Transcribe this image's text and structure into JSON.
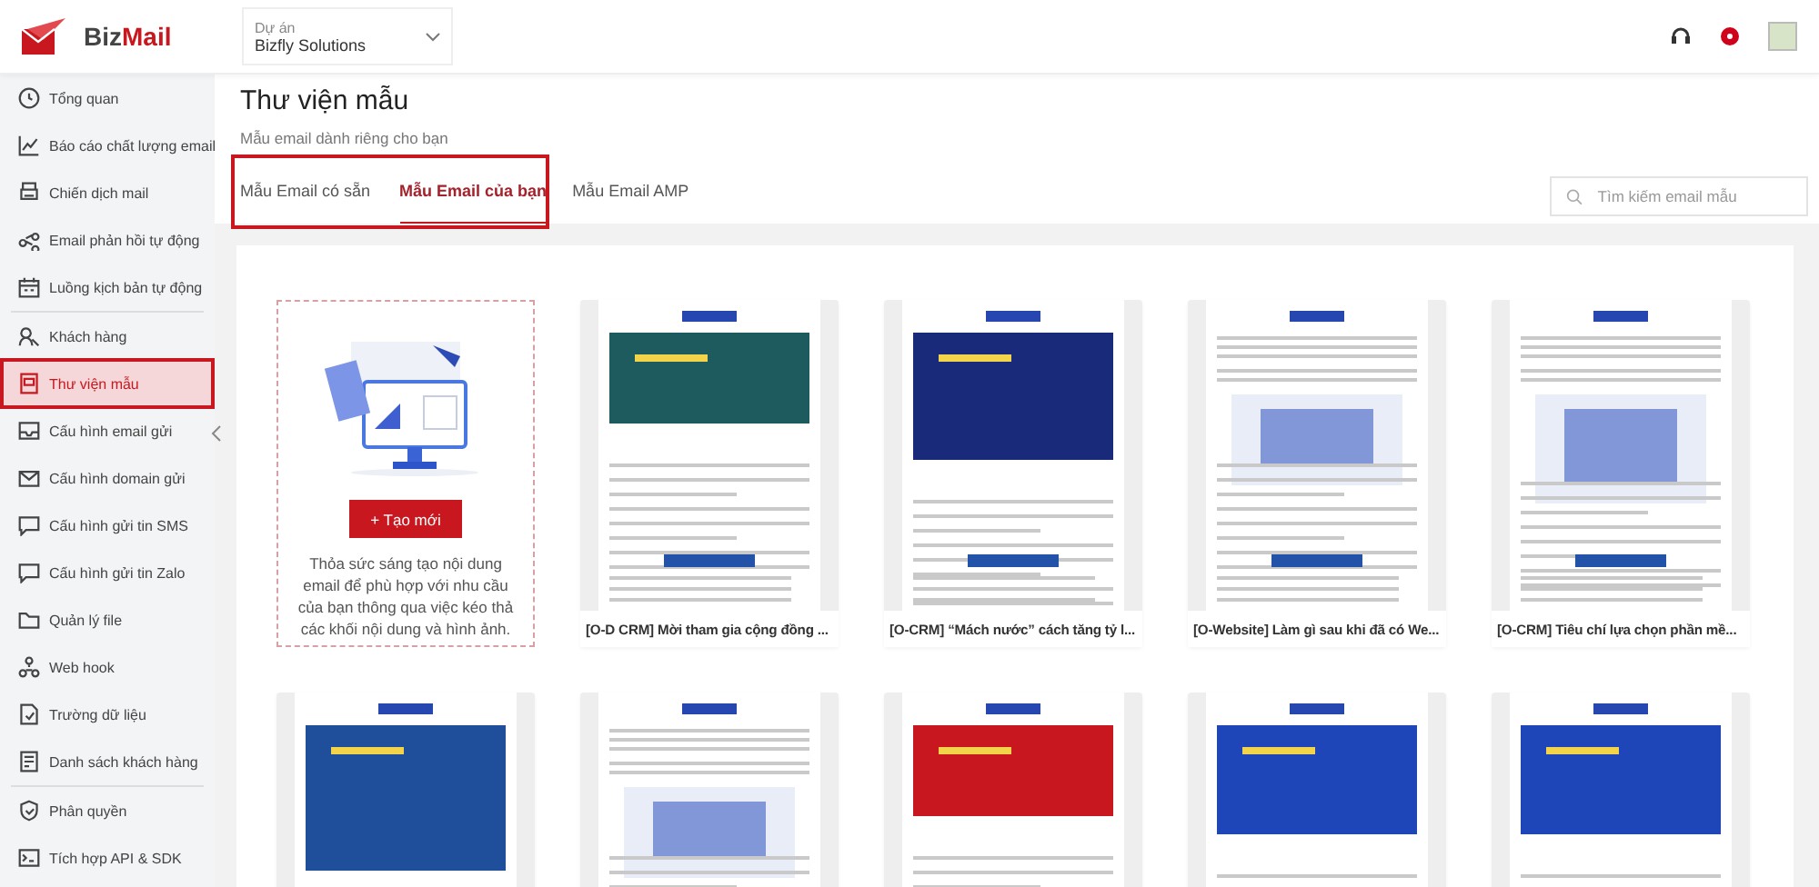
{
  "logo": {
    "first": "Biz",
    "second": "Mail"
  },
  "project_selector": {
    "label": "Dự án",
    "value": "Bizfly Solutions"
  },
  "header": {
    "notification": true
  },
  "sidebar": {
    "groups": [
      {
        "items": [
          {
            "label": "Tổng quan",
            "selected": false
          },
          {
            "label": "Báo cáo chất lượng email",
            "selected": false
          },
          {
            "label": "Chiến dịch mail",
            "selected": false
          },
          {
            "label": "Email phản hồi tự động",
            "selected": false
          },
          {
            "label": "Luồng kịch bản tự động",
            "selected": false
          }
        ]
      },
      {
        "items": [
          {
            "label": "Khách hàng",
            "selected": false
          },
          {
            "label": "Thư viện mẫu",
            "selected": true
          },
          {
            "label": "Cấu hình email gửi",
            "selected": false
          },
          {
            "label": "Cấu hình domain gửi",
            "selected": false
          },
          {
            "label": "Cấu hình gửi tin SMS",
            "selected": false
          },
          {
            "label": "Cấu hình gửi tin Zalo",
            "selected": false
          },
          {
            "label": "Quản lý file",
            "selected": false
          },
          {
            "label": "Web hook",
            "selected": false
          },
          {
            "label": "Trường dữ liệu",
            "selected": false
          },
          {
            "label": "Danh sách khách hàng",
            "selected": false
          }
        ]
      },
      {
        "items": [
          {
            "label": "Phân quyền",
            "selected": false
          },
          {
            "label": "Tích hợp API & SDK",
            "selected": false
          }
        ]
      }
    ]
  },
  "page": {
    "title": "Thư viện mẫu",
    "subtitle": "Mẫu email dành riêng cho bạn"
  },
  "tabs": [
    {
      "label": "Mẫu Email có sẵn",
      "selected": false
    },
    {
      "label": "Mẫu Email của bạn",
      "selected": true
    },
    {
      "label": "Mẫu Email AMP",
      "selected": false
    }
  ],
  "search": {
    "placeholder": "Tìm kiếm email mẫu"
  },
  "create_card": {
    "button": "+ Tạo mới",
    "description": "Thỏa sức sáng tạo nội dung email để phù hợp với nhu cầu của bạn thông qua việc kéo thả các khối nội dung và hình ảnh."
  },
  "templates": [
    {
      "title": "[O-D CRM] Mời tham gia cộng đồng ..."
    },
    {
      "title": "[O-CRM] “Mách nước” cách tăng tỷ l..."
    },
    {
      "title": "[O-Website] Làm gì sau khi đã có We..."
    },
    {
      "title": "[O-CRM] Tiêu chí lựa chọn phần mề..."
    }
  ]
}
